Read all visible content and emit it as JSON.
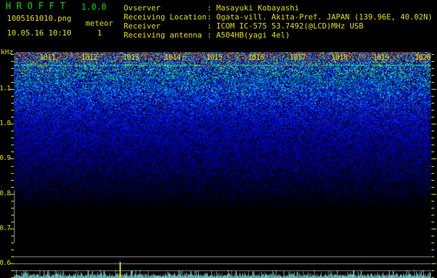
{
  "header": {
    "app_title": "H R O F F T",
    "version": "1.0.0",
    "filename": "1005161010.png",
    "mode": "meteor",
    "meteor_count": "1",
    "datetime": "10.05.16 10:10",
    "station_rows": [
      {
        "label": "Ovserver",
        "value": "Masayuki Kobayashi"
      },
      {
        "label": "Receiving Location",
        "value": "Ogata-vill. Akita-Pref. JAPAN (139.96E, 40.02N)"
      },
      {
        "label": "Receiver",
        "value": "ICOM IC-575 53.7492(@LCD)MHz USB"
      },
      {
        "label": "Receiving antenna",
        "value": "A504HB(yagi 4el)"
      }
    ]
  },
  "colors": {
    "title_green": "#00d800",
    "text_yellow": "#e0e000",
    "grey_line": "#9a9a9a",
    "waveform_cyan": "#7fd0d0",
    "marker_yellow": "#e0e000",
    "background": "#000000"
  },
  "spectrogram": {
    "unit_label": "kHz",
    "x_labels": [
      "1011",
      "1012",
      "1013",
      "1014",
      "1015",
      "1016",
      "1017",
      "1018",
      "1019",
      "1020"
    ],
    "y_tick_labels": [
      "1.1",
      "1.0",
      "0.9",
      "0.8",
      "0.7",
      "0.6"
    ]
  },
  "chart_data": {
    "type": "heatmap",
    "title": "HROFFT 1.0.0 radio meteor echo spectrogram, 10.05.16 10:10-10:20",
    "x": {
      "start": "10:10",
      "end": "10:20",
      "tick_labels": [
        "1011",
        "1012",
        "1013",
        "1014",
        "1015",
        "1016",
        "1017",
        "1018",
        "1019",
        "1020"
      ],
      "seconds_per_pixel": 1
    },
    "y": {
      "label": "kHz",
      "ticks": [
        1.1,
        1.0,
        0.9,
        0.8,
        0.7,
        0.6
      ],
      "range": [
        0.56,
        1.21
      ]
    },
    "signal": {
      "noise_gradient": "dense bright green/cyan noise near 1.2 kHz fading through blue to black near 0.6 kHz",
      "carrier_line_khz": 1.17,
      "reference_lines_khz": [
        0.62,
        0.6,
        0.58
      ],
      "level_bar_khz": [
        0.66,
        0.81
      ],
      "meteor_echoes": [
        {
          "time": "10:12:32",
          "marker_x_seconds": 152
        }
      ],
      "meteor_count_total": 1,
      "bottom_trace": "pale cyan signal-level waveform along bottom edge"
    },
    "colormap": [
      "#000000",
      "#000046",
      "#0000c8",
      "#00c8ff",
      "#00ffc8",
      "#00d23c",
      "#d7d700",
      "#d23214"
    ],
    "legend": "none",
    "grid": "off"
  }
}
